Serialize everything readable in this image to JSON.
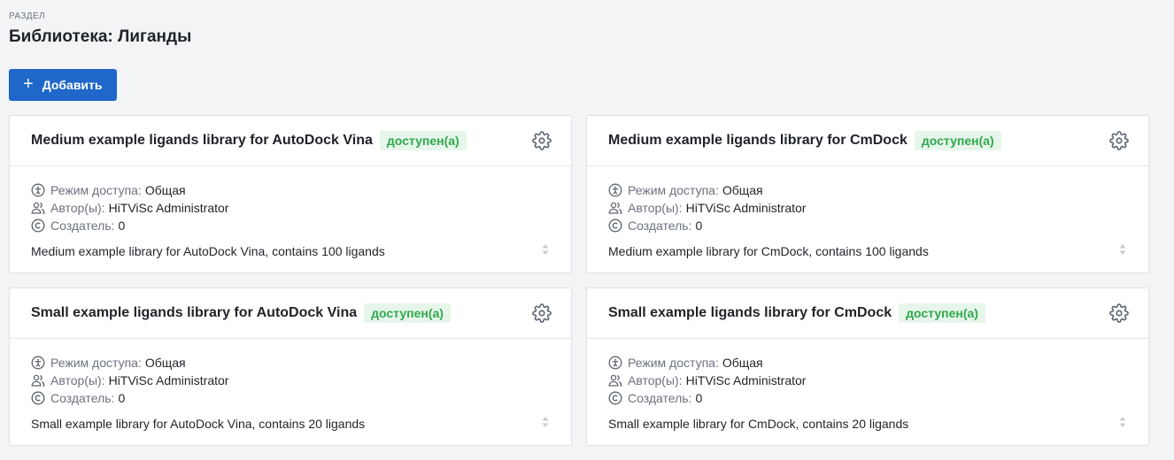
{
  "header": {
    "section_label": "РАЗДЕЛ",
    "title": "Библиотека: Лиганды"
  },
  "toolbar": {
    "add_label": "Добавить"
  },
  "meta_labels": {
    "access": "Режим доступа:",
    "authors": "Автор(ы):",
    "creator": "Создатель:"
  },
  "cards": [
    {
      "title": "Medium example ligands library for AutoDock Vina",
      "status": "доступен(а)",
      "access": "Общая",
      "authors": "HiTViSc Administrator",
      "creator": "0",
      "description": "Medium example library for AutoDock Vina, contains 100 ligands"
    },
    {
      "title": "Medium example ligands library for CmDock",
      "status": "доступен(а)",
      "access": "Общая",
      "authors": "HiTViSc Administrator",
      "creator": "0",
      "description": "Medium example library for CmDock, contains 100 ligands"
    },
    {
      "title": "Small example ligands library for AutoDock Vina",
      "status": "доступен(а)",
      "access": "Общая",
      "authors": "HiTViSc Administrator",
      "creator": "0",
      "description": "Small example library for AutoDock Vina, contains 20 ligands"
    },
    {
      "title": "Small example ligands library for CmDock",
      "status": "доступен(а)",
      "access": "Общая",
      "authors": "HiTViSc Administrator",
      "creator": "0",
      "description": "Small example library for CmDock, contains 20 ligands"
    }
  ],
  "colors": {
    "accent": "#1f67c9",
    "status_bg": "#e7f6ea",
    "status_text": "#2fa84f"
  },
  "icons": {
    "add": "plus-icon",
    "settings": "gear-icon",
    "access": "accessibility-icon",
    "authors": "users-icon",
    "creator": "copyright-icon",
    "expand": "sort-arrows-icon"
  }
}
